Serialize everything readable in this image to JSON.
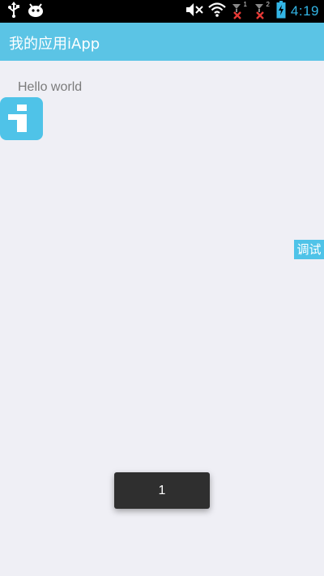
{
  "status_bar": {
    "time": "4:19",
    "left_icons": [
      "usb-icon",
      "android-debug-icon"
    ],
    "right_icons": [
      "mute-icon",
      "wifi-icon",
      "sim1-signal-icon",
      "sim2-signal-icon",
      "battery-charging-icon"
    ],
    "sim1_label": "1",
    "sim2_label": "2"
  },
  "action_bar": {
    "title": "我的应用iApp"
  },
  "main": {
    "hello_text": "Hello world",
    "debug_label": "调试",
    "toast_text": "1"
  },
  "colors": {
    "action_bar_bg": "#5bc4e5",
    "accent": "#4fc3e8",
    "clock": "#33b5e5",
    "background": "#efeff5"
  }
}
